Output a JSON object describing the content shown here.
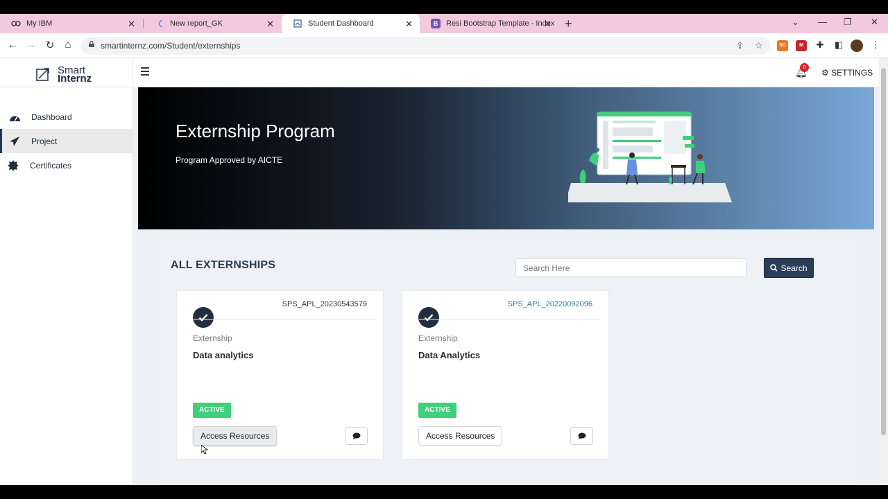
{
  "browser": {
    "tabs": [
      {
        "title": "My IBM",
        "icon": "ibm-icon",
        "active": false
      },
      {
        "title": "New report_GK",
        "icon": "report-icon",
        "active": false
      },
      {
        "title": "Student Dashboard",
        "icon": "dashboard-icon",
        "active": true
      },
      {
        "title": "Resi Bootstrap Template - Index",
        "icon": "bootstrap-icon",
        "active": false
      }
    ],
    "url": "smartinternz.com/Student/externships",
    "extensions": [
      "SC",
      "M"
    ]
  },
  "app": {
    "logo_line1": "Smart",
    "logo_line2": "Internz",
    "notification_count": "0",
    "settings_label": "SETTINGS"
  },
  "sidebar": {
    "items": [
      {
        "label": "Dashboard",
        "icon": "dashboard-icon",
        "active": false
      },
      {
        "label": "Project",
        "icon": "paper-plane-icon",
        "active": true
      },
      {
        "label": "Certificates",
        "icon": "certificate-icon",
        "active": false
      }
    ]
  },
  "hero": {
    "title": "Externship Program",
    "subtitle": "Program Approved by AICTE"
  },
  "externships": {
    "heading": "ALL EXTERNSHIPS",
    "search_placeholder": "Search Here",
    "search_button": "Search",
    "cards": [
      {
        "code": "SPS_APL_20230543579",
        "type": "Externship",
        "name": "Data analytics",
        "status": "ACTIVE",
        "action": "Access Resources"
      },
      {
        "code": "SPS_APL_20220092096",
        "type": "Externship",
        "name": "Data Analytics",
        "status": "ACTIVE",
        "action": "Access Resources"
      }
    ]
  },
  "colors": {
    "status_active": "#3fd07b",
    "primary_dark": "#2b3e59",
    "link": "#2f7a9c",
    "tabstrip": "#f3c9dd"
  }
}
